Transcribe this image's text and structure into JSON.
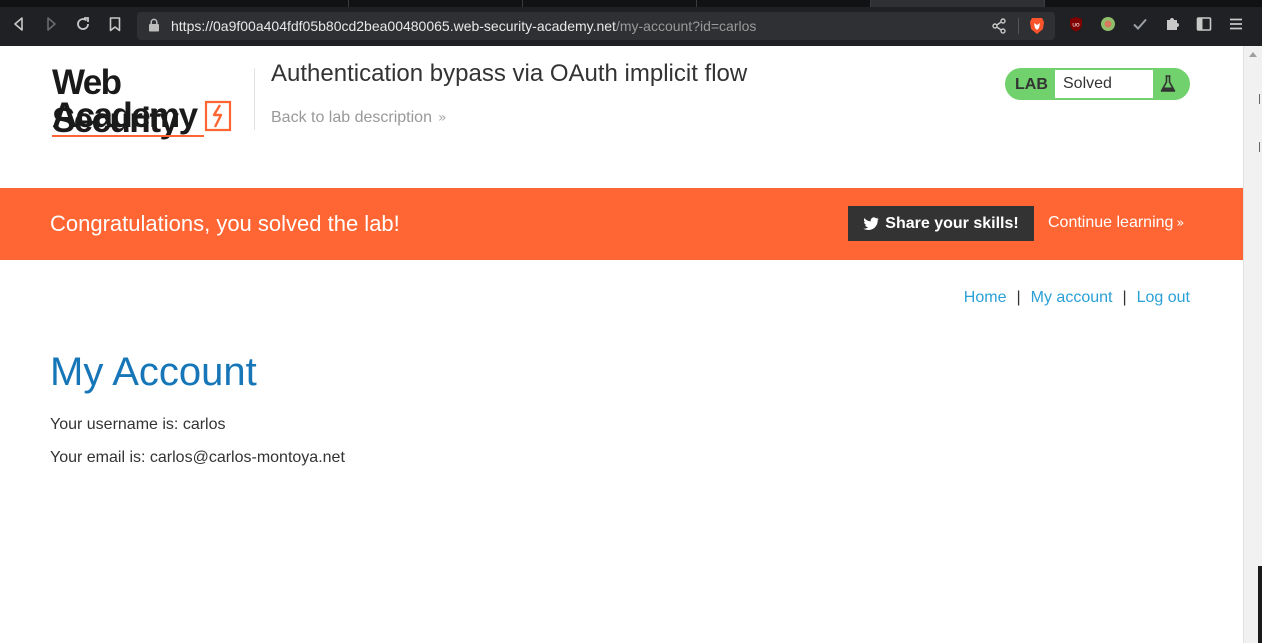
{
  "browser": {
    "url_host": "https://0a9f00a404fdf05b80cd2bea00480065.web-security-academy.net",
    "url_path": "/my-account?id=carlos",
    "nav_icons": [
      "back-icon",
      "forward-icon",
      "reload-icon",
      "bookmark-icon"
    ],
    "extension_icons": [
      "ublock-icon",
      "green-circle-extension-icon",
      "checkmark-extension-icon",
      "puzzle-extensions-icon",
      "sidebar-icon",
      "menu-icon"
    ]
  },
  "header": {
    "logo_line1": "Web Security",
    "logo_line2": "Academy",
    "lab_title": "Authentication bypass via OAuth implicit flow",
    "back_link": "Back to lab description",
    "lab_label": "LAB",
    "lab_status": "Solved"
  },
  "banner": {
    "message": "Congratulations, you solved the lab!",
    "share_label": "Share your skills!",
    "continue_label": "Continue learning"
  },
  "nav": {
    "home": "Home",
    "separator": "|",
    "my_account": "My account",
    "log_out": "Log out"
  },
  "account": {
    "title": "My Account",
    "username_line": "Your username is: carlos",
    "email_line": "Your email is: carlos@carlos-montoya.net"
  },
  "colors": {
    "brand_orange": "#ff6633",
    "status_green": "#70d16d",
    "link_blue": "#2aa0d6",
    "heading_blue": "#1676b8"
  }
}
